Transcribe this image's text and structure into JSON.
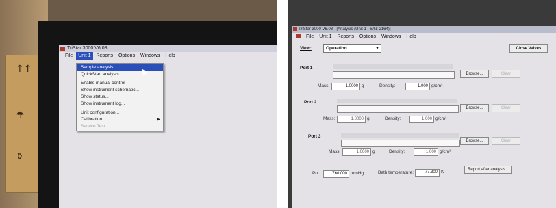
{
  "left_screen": {
    "window_title": "TriStar 3000 V6.08",
    "menu": [
      "File",
      "Unit 1",
      "Reports",
      "Options",
      "Windows",
      "Help"
    ],
    "active_menu_index": 1,
    "dropdown": [
      {
        "label": "Sample analysis...",
        "state": "highlighted"
      },
      {
        "label": "QuickStart analysis...",
        "state": "normal"
      },
      {
        "separator": true
      },
      {
        "label": "Enable manual control",
        "state": "normal"
      },
      {
        "label": "Show instrument schematic...",
        "state": "normal"
      },
      {
        "label": "Show status...",
        "state": "normal"
      },
      {
        "label": "Show instrument log...",
        "state": "normal"
      },
      {
        "separator": true
      },
      {
        "label": "Unit configuration...",
        "state": "normal"
      },
      {
        "label": "Calibration",
        "state": "submenu"
      },
      {
        "label": "Service Test...",
        "state": "disabled"
      }
    ]
  },
  "right_screen": {
    "window_title": "TriStar 3000 V6.08 - [Analysis (Unit 1 - S/N: 2164)]",
    "menu": [
      "File",
      "Unit 1",
      "Reports",
      "Options",
      "Windows",
      "Help"
    ],
    "view_label": "View:",
    "view_value": "Operation",
    "close_valves_label": "Close Valves",
    "ports": [
      {
        "label": "Port 1",
        "mass_label": "Mass:",
        "mass_value": "1.0000",
        "mass_unit": "g",
        "density_label": "Density:",
        "density_value": "1.000",
        "density_unit": "g/cm³",
        "browse_label": "Browse...",
        "clear_label": "Clear"
      },
      {
        "label": "Port 2",
        "mass_label": "Mass:",
        "mass_value": "1.0000",
        "mass_unit": "g",
        "density_label": "Density:",
        "density_value": "1.000",
        "density_unit": "g/cm³",
        "browse_label": "Browse...",
        "clear_label": "Clear"
      },
      {
        "label": "Port 3",
        "mass_label": "Mass:",
        "mass_value": "1.0000",
        "mass_unit": "g",
        "density_label": "Density:",
        "density_value": "1.000",
        "density_unit": "g/cm³",
        "browse_label": "Browse...",
        "clear_label": "Clear"
      }
    ],
    "po_label": "Po:",
    "po_value": "760.000",
    "po_unit": "mmHg",
    "bath_label": "Bath temperature:",
    "bath_value": "77.300",
    "bath_unit": "K",
    "report_button": "Report after analysis..."
  },
  "colors": {
    "menu_highlight": "#2a4fb8",
    "app_icon": "#b0382a",
    "screen_bg": "#e4e2e6"
  }
}
